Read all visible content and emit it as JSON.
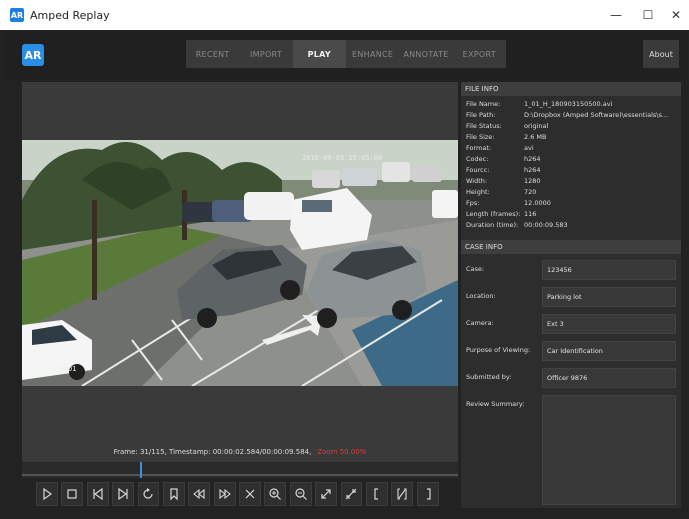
{
  "window": {
    "title": "Amped Replay",
    "icon_text": "AR"
  },
  "topbar": {
    "logo_text": "AR",
    "tabs": [
      {
        "label": "RECENT",
        "active": false
      },
      {
        "label": "IMPORT",
        "active": false
      },
      {
        "label": "PLAY",
        "active": true
      },
      {
        "label": "ENHANCE",
        "active": false
      },
      {
        "label": "ANNOTATE",
        "active": false
      },
      {
        "label": "EXPORT",
        "active": false
      }
    ],
    "about_label": "About"
  },
  "video": {
    "camera_label": "CAM01",
    "overlay_timestamp": "2018-09-03 15:05:00"
  },
  "status": {
    "frame_text": "Frame: 31/115, Timestamp: 00:00:02.584/00:00:09.584,",
    "zoom_text": "Zoom 50.00%",
    "zoom_color": "#e03a3a",
    "timeline_progress": 0.27
  },
  "controls": [
    "play-icon",
    "stop-icon",
    "previous-frame-icon",
    "next-frame-icon",
    "loop-icon",
    "bookmark-icon",
    "rewind-icon",
    "fast-forward-icon",
    "close-icon",
    "zoom-in-icon",
    "zoom-out-icon",
    "fit-expand-icon",
    "fit-shrink-icon",
    "mark-in-icon",
    "clear-marks-icon",
    "mark-out-icon"
  ],
  "file_info": {
    "header": "FILE INFO",
    "rows": [
      {
        "k": "File Name:",
        "v": "1_01_H_180903150500.avi"
      },
      {
        "k": "File Path:",
        "v": "D:\\Dropbox (Amped Software)\\essentials\\s..."
      },
      {
        "k": "File Status:",
        "v": "original"
      },
      {
        "k": "File Size:",
        "v": "2.6 MB"
      },
      {
        "k": "Format:",
        "v": "avi"
      },
      {
        "k": "Codec:",
        "v": "h264"
      },
      {
        "k": "Fourcc:",
        "v": "h264"
      },
      {
        "k": "Width:",
        "v": "1280"
      },
      {
        "k": "Height:",
        "v": "720"
      },
      {
        "k": "Fps:",
        "v": "12.0000"
      },
      {
        "k": "Length (frames):",
        "v": "116"
      },
      {
        "k": "Duration (time):",
        "v": "00:00:09.583"
      }
    ]
  },
  "case_info": {
    "header": "CASE INFO",
    "case_label": "Case:",
    "case_value": "123456",
    "location_label": "Location:",
    "location_value": "Parking lot",
    "camera_label": "Camera:",
    "camera_value": "Ext 3",
    "purpose_label": "Purpose of Viewing:",
    "purpose_value": "Car Identification",
    "submitted_label": "Submitted by:",
    "submitted_value": "Officer 9876",
    "summary_label": "Review Summary:",
    "summary_value": ""
  }
}
